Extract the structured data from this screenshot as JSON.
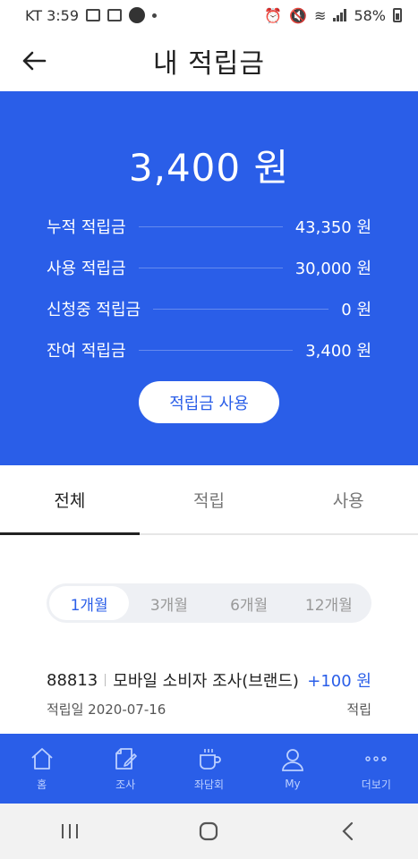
{
  "status_bar": {
    "carrier_time": "KT 3:59",
    "battery": "58%"
  },
  "header": {
    "title": "내 적립금"
  },
  "summary": {
    "balance": "3,400 원",
    "rows": [
      {
        "label": "누적 적립금",
        "value": "43,350 원"
      },
      {
        "label": "사용 적립금",
        "value": "30,000 원"
      },
      {
        "label": "신청중 적립금",
        "value": "0 원"
      },
      {
        "label": "잔여 적립금",
        "value": "3,400 원"
      }
    ],
    "use_button": "적립금 사용"
  },
  "tabs": [
    {
      "label": "전체",
      "active": true
    },
    {
      "label": "적립",
      "active": false
    },
    {
      "label": "사용",
      "active": false
    }
  ],
  "period_options": [
    {
      "label": "1개월",
      "active": true
    },
    {
      "label": "3개월",
      "active": false
    },
    {
      "label": "6개월",
      "active": false
    },
    {
      "label": "12개월",
      "active": false
    }
  ],
  "history": [
    {
      "code": "88813",
      "title": "모바일 소비자 조사(브랜드)",
      "amount": "+100 원",
      "date": "적립일 2020-07-16",
      "type": "적립"
    }
  ],
  "bottom_nav": [
    {
      "label": "홈",
      "icon": "home-icon"
    },
    {
      "label": "조사",
      "icon": "survey-icon"
    },
    {
      "label": "좌담회",
      "icon": "cup-icon"
    },
    {
      "label": "My",
      "icon": "user-icon"
    },
    {
      "label": "더보기",
      "icon": "more-icon"
    }
  ],
  "colors": {
    "primary": "#2a5ee8",
    "nav_text": "#bcd0ff"
  }
}
